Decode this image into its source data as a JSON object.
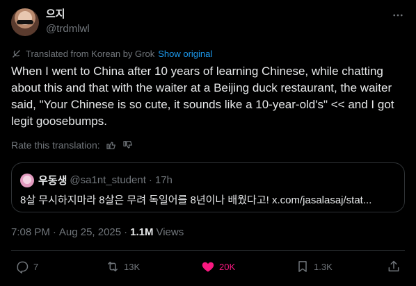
{
  "author": {
    "name": "으지",
    "handle": "@trdmlwl"
  },
  "translation": {
    "notice": "Translated from Korean by Grok",
    "show_original": "Show original",
    "rate_prompt": "Rate this translation:"
  },
  "tweet": {
    "text": "When I went to China after 10 years of learning Chinese, while chatting about this and that with the waiter at a Beijing duck restaurant, the waiter said, \"Your Chinese is so cute, it sounds like a 10-year-old's\" << and I got legit goosebumps.",
    "time": "7:08 PM",
    "separator": "·",
    "date": "Aug 25, 2025",
    "views_count": "1.1M",
    "views_label": "Views"
  },
  "quote": {
    "name": "우동생",
    "handle": "@sa1nt_student",
    "separator": "·",
    "age": "17h",
    "text": "8살 무시하지마라 8살은 무려 독일어를 8년이나 배웠다고! x.com/jasalasaj/stat..."
  },
  "actions": {
    "replies": "7",
    "reposts": "13K",
    "likes": "20K",
    "bookmarks": "1.3K"
  },
  "colors": {
    "accent": "#1d9bf0",
    "like": "#f91880",
    "muted": "#71767b",
    "text": "#e7e9ea",
    "border": "#2f3336"
  }
}
